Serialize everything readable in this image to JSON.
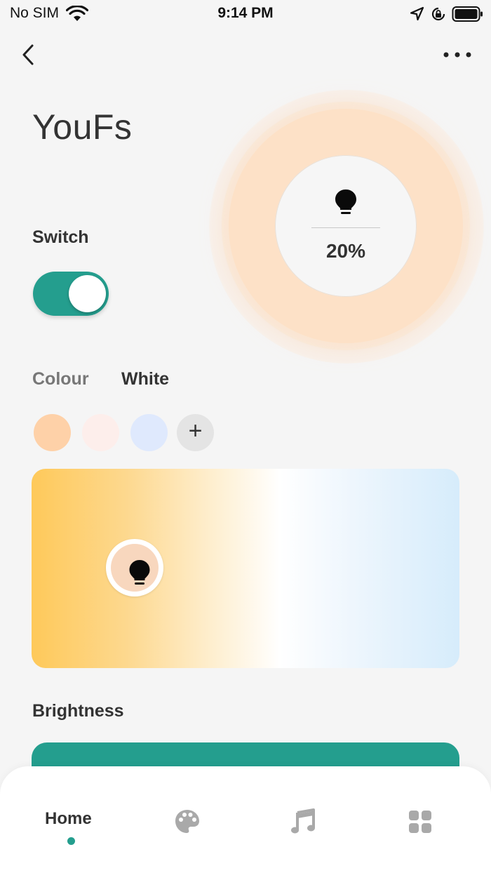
{
  "status_bar": {
    "carrier": "No SIM",
    "time": "9:14 PM"
  },
  "device": {
    "title": "YouFs",
    "brightness_percent": "20%"
  },
  "switch": {
    "label": "Switch",
    "on": true
  },
  "tabs": {
    "colour": "Colour",
    "white": "White",
    "selected": "White"
  },
  "swatches": {
    "colors": [
      "#fed1a8",
      "#fdeeeb",
      "#dfe9fd"
    ],
    "add_label": "+"
  },
  "brightness": {
    "label": "Brightness"
  },
  "nav": {
    "home_label": "Home",
    "items": [
      "home",
      "palette-icon",
      "music-icon",
      "grid-icon"
    ]
  },
  "colors": {
    "accent": "#249e8e",
    "ring": "#fde1c7"
  }
}
